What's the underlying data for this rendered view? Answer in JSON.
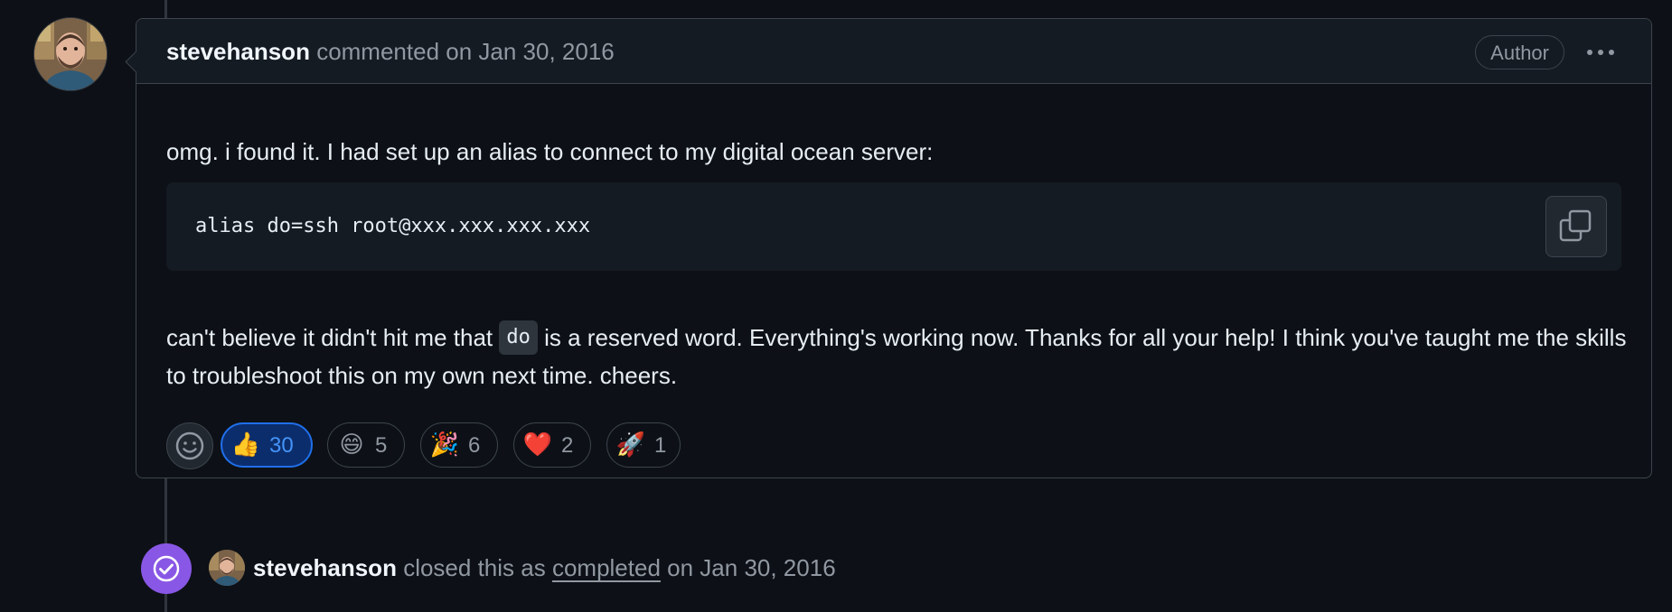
{
  "comment": {
    "author": "stevehanson",
    "meta": "commented on Jan 30, 2016",
    "badge": "Author",
    "menu_icon": "kebab-horizontal-icon",
    "paragraph1": "omg. i found it. I had set up an alias to connect to my digital ocean server:",
    "code": "alias do=ssh root@xxx.xxx.xxx.xxx",
    "copy_icon": "copy-icon",
    "paragraph2_before": "can't believe it didn't hit me that",
    "paragraph2_code": "do",
    "paragraph2_after": "is a reserved word. Everything's working now. Thanks for all your help! I think you've taught me the skills to troubleshoot this on my own next time. cheers.",
    "reactions": [
      {
        "emoji": "👍",
        "name": "thumbs-up",
        "count": "30",
        "active": true
      },
      {
        "emoji": "😄",
        "name": "smile",
        "count": "5",
        "active": false
      },
      {
        "emoji": "🎉",
        "name": "tada",
        "count": "6",
        "active": false
      },
      {
        "emoji": "❤️",
        "name": "heart",
        "count": "2",
        "active": false
      },
      {
        "emoji": "🚀",
        "name": "rocket",
        "count": "1",
        "active": false
      }
    ]
  },
  "event": {
    "actor": "stevehanson",
    "action": "closed this as",
    "state": "completed",
    "date": "on Jan 30, 2016",
    "icon": "issue-closed-check-icon"
  },
  "colors": {
    "background": "#0d1117",
    "border": "#3d444d",
    "accent": "#1f6feb",
    "closed_purple": "#8957e5",
    "muted": "#9198a1"
  }
}
